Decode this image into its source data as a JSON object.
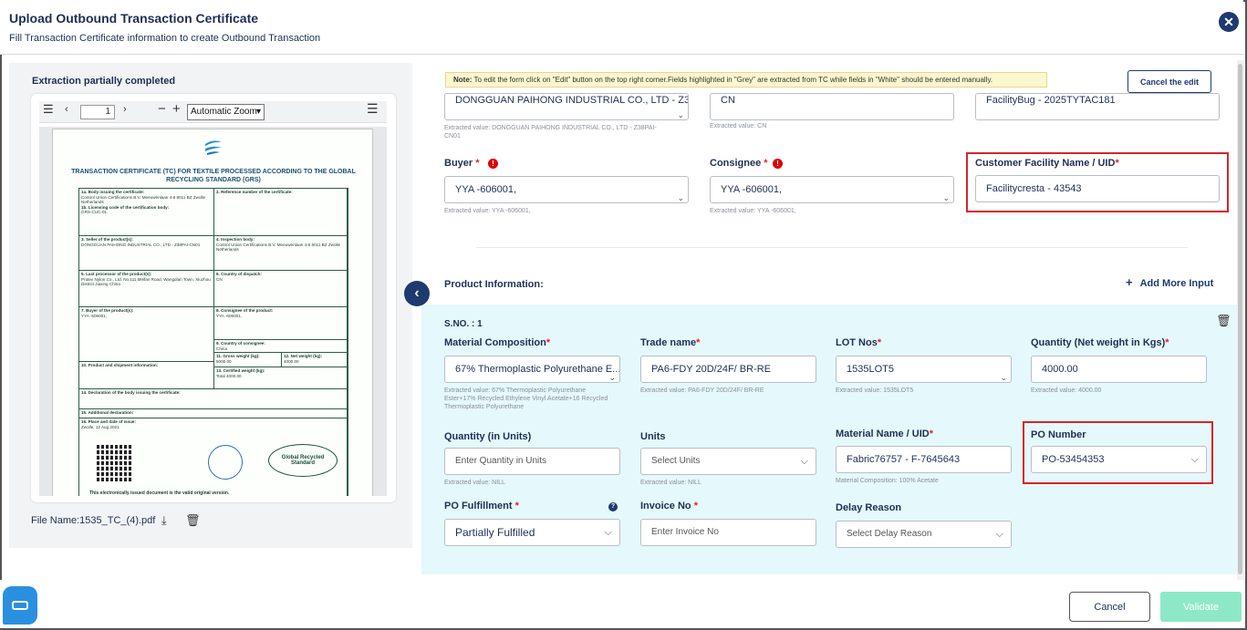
{
  "header": {
    "title": "Upload Outbound Transaction Certificate",
    "subtitle": "Fill Transaction Certificate information to create Outbound Transaction",
    "close_icon": "close-icon"
  },
  "viewer": {
    "status": "Extraction partially completed",
    "page": "1",
    "zoom": "Automatic Zoom",
    "file_name": "File Name:1535_TC_(4).pdf",
    "cert": {
      "title": "TRANSACTION CERTIFICATE (TC) FOR TEXTILE PROCESSED ACCORDING TO THE GLOBAL RECYCLING STANDARD (GRS)",
      "c1": "1a. Body issuing the certificate:",
      "c1v": "Control Union Certifications B.V. Meeuwenlaan 4-6 8011 BZ Zwolle Netherlands",
      "c1b": "1b. Licensing code of the certification body:",
      "c1bv": "GRS-CUC-01",
      "c2": "2. Reference number of the certificate:",
      "c3": "3. Seller of the product(s):",
      "c3v": "DONGGUAN PAIHONG INDUSTRIAL CO., LTD - Z38PAI-CN01",
      "c4": "4. Inspection body:",
      "c4v": "Control Union Certifications B.V. Meeuwenlaan 4-6 8011 BZ Zwolle Netherlands",
      "c5": "5. Last processor of the product(s):",
      "c5v": "Prutex Nylon Co., Ltd. No.111,Meifan Road, Wangdian Town, Xiuzhou District Jiaxing China",
      "c6": "6. Country of dispatch:",
      "c6v": "CN",
      "c7": "7. Buyer of the product(s):",
      "c7v": "YYA -606001,",
      "c8": "8. Consignee of the product:",
      "c8v": "YYA -606001,",
      "c9": "9. Country of consignee:",
      "c9v": "China",
      "c10": "10. Product and shipment information:",
      "c11": "11. Gross weight (kg):",
      "c11v": "5000.00",
      "c12": "12. Net weight (kg):",
      "c12v": "4000.00",
      "c13": "13. Certified weight (kg):",
      "c13v": "Total 4000.00",
      "c14": "14. Declaration of the body issuing the certificate:",
      "c15": "15. Additional declaration:",
      "c16": "16. Place and date of issue:",
      "c16v": "Zwolle, 12 Aug 2021",
      "grs": "Global Recycled Standard",
      "footer": "This electronically issued document is the valid original version."
    }
  },
  "form": {
    "note_bold": "Note:",
    "note": " To edit the form click on \"Edit\" button on the top right corner.Fields highlighted in \"Grey\" are extracted from TC while fields in \"White\" should be entered manually.",
    "cancel_edit": "Cancel the edit",
    "seller_value": "DONGGUAN PAIHONG INDUSTRIAL CO., LTD - Z38PAI-...",
    "seller_extracted": "Extracted value: DONGGUAN PAIHONG INDUSTRIAL CO., LTD - Z38PAI-CN01",
    "country_value": "CN",
    "country_extracted": "Extracted value: CN",
    "facility_top_value": "FacilityBug - 2025TYTAC181",
    "buyer_label": "Buyer",
    "buyer_value": "YYA -606001,",
    "buyer_extracted": "Extracted value: YYA -606001,",
    "consignee_label": "Consignee",
    "consignee_value": "YYA -606001,",
    "consignee_extracted": "Extracted value: YYA -606001,",
    "customer_facility_label": "Customer Facility Name / UID",
    "customer_facility_value": "Facilitycresta - 43543",
    "product_info": "Product Information:",
    "add_more": "Add More Input",
    "sno": "S.NO. : 1",
    "material_comp_label": "Material Composition",
    "material_comp_value": "67% Thermoplastic Polyurethane E...",
    "material_comp_extracted": "Extracted value: 67% Thermoplastic Polyurethane Ester+17% Recycled Ethylene Vinyl Acetate+16 Recycled Thermoplastic Polyurethane",
    "trade_label": "Trade name",
    "trade_value": "PA6-FDY 20D/24F/ BR-RE",
    "trade_extracted": "Extracted value: PA6-FDY 20D/24F/ BR-RE",
    "lot_label": "LOT Nos",
    "lot_value": "1535LOT5",
    "lot_extracted": "Extracted value: 1535LOT5",
    "qty_kg_label": "Quantity (Net weight in Kgs)",
    "qty_kg_value": "4000.00",
    "qty_kg_extracted": "Extracted value: 4000.00",
    "qty_units_label": "Quantity (in Units)",
    "qty_units_placeholder": "Enter Quantity in Units",
    "qty_units_extracted": "Extracted value: NILL",
    "units_label": "Units",
    "units_placeholder": "Select Units",
    "units_extracted": "Extracted value: NILL",
    "material_name_label": "Material Name / UID",
    "material_name_value": "Fabric76757 - F-7645643",
    "material_name_extracted": "Material Composition: 100% Acetate",
    "po_label": "PO Number",
    "po_value": "PO-53454353",
    "po_fulfil_label": "PO Fulfillment",
    "po_fulfil_value": "Partially Fulfilled",
    "invoice_label": "Invoice No",
    "invoice_placeholder": "Enter Invoice No",
    "delay_label": "Delay Reason",
    "delay_placeholder": "Select Delay Reason",
    "req": "*"
  },
  "footer": {
    "cancel": "Cancel",
    "validate": "Validate"
  }
}
